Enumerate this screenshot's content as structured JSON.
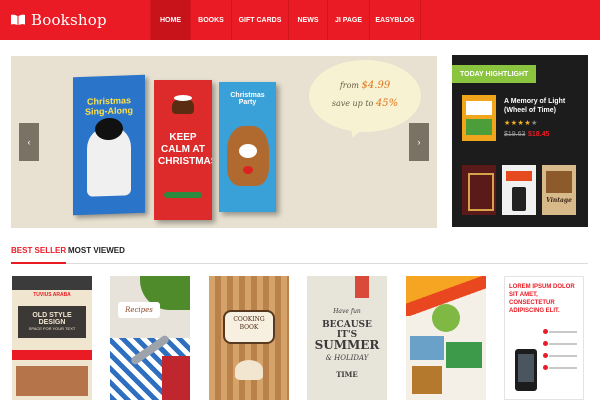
{
  "header": {
    "logo_text": "Bookshop",
    "logo_icon": "open-book-icon",
    "nav": [
      {
        "label": "HOME",
        "active": true
      },
      {
        "label": "BOOKS",
        "active": false
      },
      {
        "label": "GIFT CARDS",
        "active": false
      },
      {
        "label": "NEWS",
        "active": false
      },
      {
        "label": "JI PAGE",
        "active": false
      },
      {
        "label": "EASYBLOG",
        "active": false
      }
    ],
    "brand_color": "#ea1b24"
  },
  "slider": {
    "prev_icon": "chevron-left-icon",
    "next_icon": "chevron-right-icon",
    "prev_glyph": "‹",
    "next_glyph": "›",
    "bubble_from": "from",
    "bubble_price": "$4.99",
    "bubble_save": "save up to",
    "bubble_percent": "45%",
    "covers": [
      {
        "title": "Christmas Sing-Along"
      },
      {
        "title": "KEEP CALM AT CHRISTMAS"
      },
      {
        "title": "Christmas Party"
      }
    ]
  },
  "highlight": {
    "heading": "TODAY HIGHTLIGHT",
    "book_title": "A Memory of Light (Wheel of Time)",
    "rating": 4,
    "stars_filled": "★★★★",
    "stars_empty": "★",
    "old_price": "$19.63",
    "new_price": "$18.45",
    "small_books": [
      {
        "label": ""
      },
      {
        "label": ""
      },
      {
        "label": "Vintage"
      }
    ]
  },
  "tabs": [
    {
      "label": "BEST SELLER",
      "active": true
    },
    {
      "label": "MOST VIEWED",
      "active": false
    }
  ],
  "books": [
    {
      "name": "TUVIUS ARABA",
      "title": "OLD STYLE DESIGN",
      "subtitle": "SPACE FOR YOUR TEXT"
    },
    {
      "name": "Recipes"
    },
    {
      "name": "COOKING BOOK"
    },
    {
      "line1": "Have fun",
      "line2": "BECAUSE IT'S",
      "line3": "SUMMER",
      "line4": "& HOLIDAY",
      "line5": "TIME"
    },
    {
      "name": ""
    },
    {
      "headline": "LOREM IPSUM DOLOR SIT AMET, CONSECTETUR ADIPISCING ELIT."
    }
  ]
}
